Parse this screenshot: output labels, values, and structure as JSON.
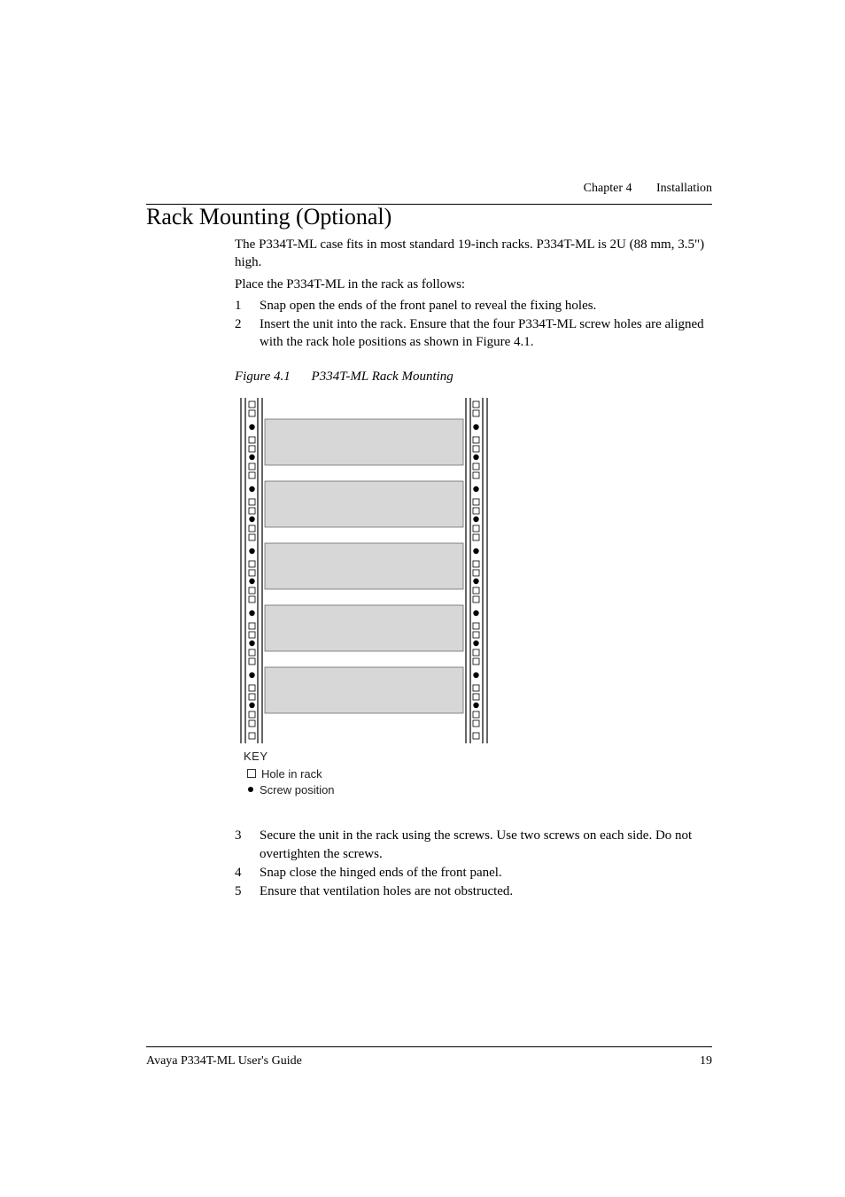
{
  "chapter": {
    "label": "Chapter 4",
    "title": "Installation"
  },
  "section": {
    "title": "Rack Mounting (Optional)"
  },
  "intro": [
    "The P334T-ML case fits in most standard 19-inch racks. P334T-ML is 2U (88 mm, 3.5\") high.",
    "Place the P334T-ML in the rack as follows:"
  ],
  "list_first": [
    {
      "num": "1",
      "text": "Snap open the ends of the front panel to reveal the fixing holes."
    },
    {
      "num": "2",
      "text": "Insert the unit into the rack. Ensure that the four P334T-ML screw holes are aligned with the rack hole positions as shown in Figure 4.1."
    }
  ],
  "figure": {
    "ref": "Figure 4.1",
    "caption": "P334T-ML Rack Mounting",
    "key_title": "KEY",
    "key_hole": "Hole in rack",
    "key_screw": "Screw position"
  },
  "list_second": [
    {
      "num": "3",
      "text": "Secure the unit in the rack using the screws. Use two screws on each side. Do not overtighten the screws."
    },
    {
      "num": "4",
      "text": "Snap close the hinged ends of the front panel."
    },
    {
      "num": "5",
      "text": "Ensure that ventilation holes are not obstructed."
    }
  ],
  "footer": {
    "guide": "Avaya P334T-ML User's Guide",
    "page": "19"
  }
}
